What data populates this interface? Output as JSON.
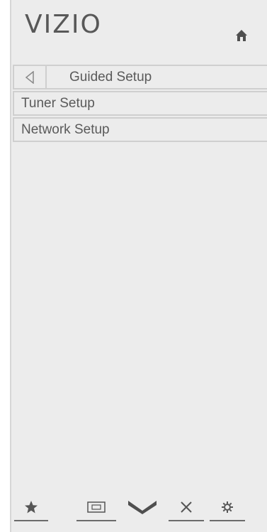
{
  "header": {
    "brand": "VIZIO",
    "home_icon": "home-icon"
  },
  "menu": {
    "title": "Guided Setup",
    "back_icon": "back-triangle-icon",
    "items": [
      {
        "label": "Tuner Setup"
      },
      {
        "label": "Network Setup"
      }
    ]
  },
  "bottom_bar": {
    "items": [
      {
        "icon": "star-icon"
      },
      {
        "icon": "widescreen-icon"
      },
      {
        "icon": "vizio-v-icon"
      },
      {
        "icon": "close-icon"
      },
      {
        "icon": "gear-icon"
      }
    ]
  },
  "colors": {
    "panel_bg": "#ececec",
    "text": "#5a5a5a",
    "border": "#cfcfcf"
  }
}
